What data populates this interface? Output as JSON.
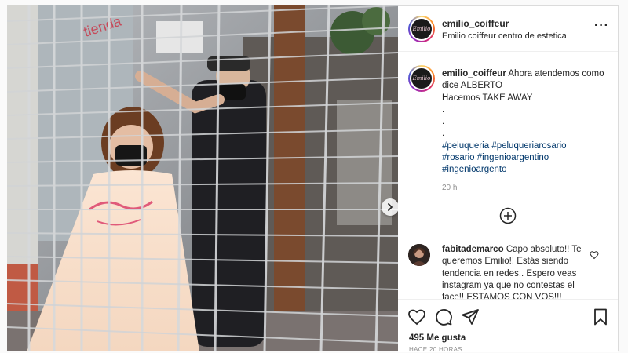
{
  "post": {
    "username": "emilio_coiffeur",
    "subtitle": "Emilio coiffeur centro de estetica",
    "more_icon": "more-options-icon",
    "avatar_text": "Emilio",
    "caption": {
      "username": "emilio_coiffeur",
      "line1": "Ahora atendemos como dice ALBERTO",
      "line2": "Hacemos TAKE AWAY",
      "dots": [
        ".",
        ".",
        "."
      ],
      "hashtags": [
        "#peluqueria",
        "#peluqueriarosario",
        "#rosario",
        "#ingenioargentino",
        "#ingenioargento"
      ]
    },
    "caption_time": "20 h",
    "comment": {
      "username": "fabitademarco",
      "text": "Capo absoluto!! Te queremos Emilio!! Estás siendo tendencia en redes.. Espero veas instagram ya que no contestas el face!! ESTAMOS CON VOS!!!"
    },
    "likes": "495 Me gusta",
    "time_ago": "HACE 20 HORAS"
  },
  "icons": {
    "next": "chevron-right-icon",
    "add_comment": "plus-circle-icon",
    "like": "heart-icon",
    "comment": "comment-icon",
    "share": "send-icon",
    "save": "bookmark-icon"
  },
  "colors": {
    "hashtag": "#00376b",
    "muted": "#8e8e8e",
    "text": "#262626",
    "border": "#dbdbdb"
  }
}
